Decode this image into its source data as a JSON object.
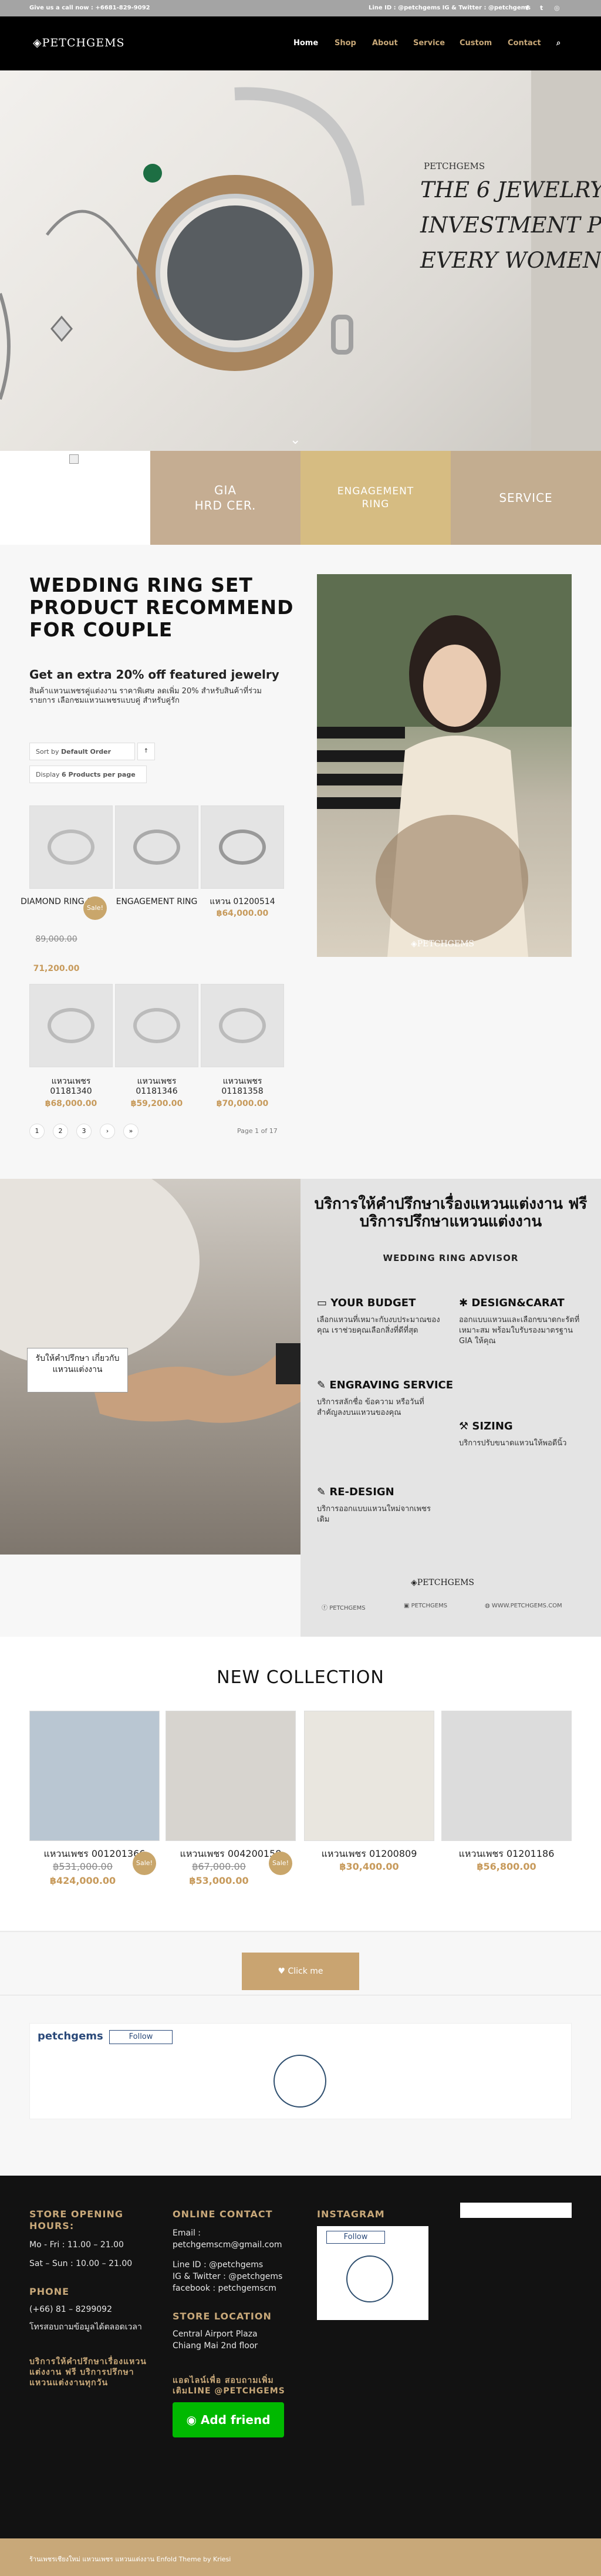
{
  "topbar": {
    "left": "Give us a call now : +6681-829-9092",
    "right": "Line ID : @petchgems IG & Twitter : @petchgems",
    "social": [
      "f",
      "t",
      "ig"
    ]
  },
  "header": {
    "logo": "PETCHGEMS",
    "nav": [
      "Home",
      "Shop",
      "About",
      "Service",
      "Custom",
      "Contact"
    ],
    "search_icon": "search-icon"
  },
  "hero": {
    "brand": "PETCHGEMS",
    "lines": [
      "THE 6 JEWELRY",
      "INVESTMENT PI",
      "EVERY WOMEN I"
    ]
  },
  "categories": [
    "GIA\nHRD CER.",
    "ENGAGEMENT\nRING",
    "SERVICE"
  ],
  "section": {
    "title": "WEDDING RING SET PRODUCT RECOMMEND FOR COUPLE",
    "subtitle": "Get an extra 20% off featured jewelry",
    "thai": "สินค้าแหวนเพชรคู่แต่งงาน ราคาพิเศษ ลดเพิ่ม 20% สำหรับสินค้าที่ร่วมรายการ เลือกชมแหวนเพชรแบบคู่ สำหรับคู่รัก",
    "sort_label": "Sort by",
    "sort_value": "Default Order",
    "display_label": "Display",
    "display_value": "6 Products per page",
    "products": [
      {
        "name": "DIAMOND RING 8",
        "old": "89,000.00",
        "price": "71,200.00",
        "sale": "Sale!"
      },
      {
        "name": "ENGAGEMENT RING",
        "old": "",
        "price": "",
        "sale": ""
      },
      {
        "name": "แหวน 01200514",
        "old": "",
        "price": "฿64,000.00",
        "sale": ""
      },
      {
        "name": "แหวนเพชร 01181340",
        "old": "",
        "price": "฿68,000.00",
        "sale": ""
      },
      {
        "name": "แหวนเพชร 01181346",
        "old": "",
        "price": "฿59,200.00",
        "sale": ""
      },
      {
        "name": "แหวนเพชร 01181358",
        "old": "",
        "price": "฿70,000.00",
        "sale": ""
      }
    ],
    "pages": [
      "1",
      "2",
      "3",
      "›",
      "»"
    ],
    "page_info": "Page 1 of 17"
  },
  "advisor": {
    "badge": "รับให้คำปรึกษา เกี่ยวกับแหวนแต่งงาน",
    "title": "บริการให้คำปรึกษาเรื่องแหวนแต่งงาน ฟรี บริการปรึกษาแหวนแต่งงาน",
    "subtitle": "WEDDING RING ADVISOR",
    "items": [
      {
        "h": "YOUR BUDGET",
        "p": "เลือกแหวนที่เหมาะกับงบประมาณของคุณ เราช่วยคุณเลือกสิ่งที่ดีที่สุด"
      },
      {
        "h": "DESIGN&CARAT",
        "p": "ออกแบบแหวนและเลือกขนาดกะรัตที่เหมาะสม พร้อมใบรับรองมาตรฐาน GIA ให้คุณ"
      },
      {
        "h": "ENGRAVING SERVICE",
        "p": "บริการสลักชื่อ ข้อความ หรือวันที่สำคัญลงบนแหวนของคุณ"
      },
      {
        "h": "SIZING",
        "p": "บริการปรับขนาดแหวนให้พอดีนิ้ว"
      },
      {
        "h": "RE-DESIGN",
        "p": "บริการออกแบบแหวนใหม่จากเพชรเดิม"
      }
    ],
    "brand": "PETCHGEMS",
    "footer": [
      "PETCHGEMS",
      "PETCHGEMS",
      "WWW.PETCHGEMS.COM"
    ]
  },
  "new_collection": {
    "title": "NEW COLLECTION",
    "items": [
      {
        "name": "แหวนเพชร 001201366",
        "old": "฿531,000.00",
        "price": "฿424,000.00",
        "sale": "Sale!"
      },
      {
        "name": "แหวนเพชร 004200158",
        "old": "฿67,000.00",
        "price": "฿53,000.00",
        "sale": "Sale!"
      },
      {
        "name": "แหวนเพชร 01200809",
        "old": "",
        "price": "฿30,400.00",
        "sale": ""
      },
      {
        "name": "แหวนเพชร 01201186",
        "old": "",
        "price": "฿56,800.00",
        "sale": ""
      }
    ],
    "click_me": "♥ Click me"
  },
  "instagram": {
    "user": "petchgems",
    "follow": "Follow"
  },
  "footer": {
    "opening_title": "STORE OPENING HOURS:",
    "hours": [
      "Mo - Fri : 11.00 – 21.00",
      "Sat – Sun : 10.00 – 21.00"
    ],
    "phone_title": "PHONE",
    "phone": "(+66) 81 – 8299092",
    "phone_note": "โทรสอบถามข้อมูลได้ตลอดเวลา",
    "thai_promo": "บริการให้คำปรึกษาเรื่องแหวนแต่งงาน ฟรี บริการปรึกษาแหวนแต่งงานทุกวัน",
    "online_title": "ONLINE CONTACT",
    "email_label": "Email :",
    "email": "petchgemscm@gmail.com",
    "line": "Line ID : @petchgems",
    "ig_tw": "IG & Twitter : @petchgems",
    "fb": "facebook : petchgemscm",
    "location_title": "STORE LOCATION",
    "location": [
      "Central Airport Plaza",
      "Chiang Mai 2nd floor"
    ],
    "line_add_title": "แอดไลน์เพื่อ สอบถามเพิ่มเติมLINE @PETCHGEMS",
    "add_friend": "Add friend",
    "instagram_title": "INSTAGRAM",
    "ig_follow": "Follow"
  },
  "bottom": {
    "text": "ร้านเพชรเชียงใหม่ แหวนเพชร แหวนแต่งงาน Enfold Theme by Kriesi"
  }
}
